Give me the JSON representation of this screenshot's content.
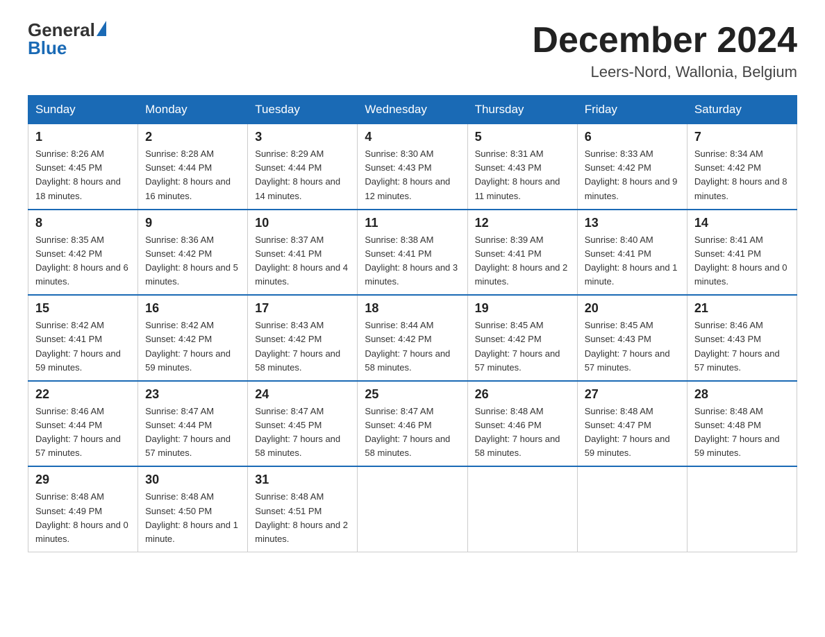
{
  "header": {
    "logo_general": "General",
    "logo_blue": "Blue",
    "month_title": "December 2024",
    "location": "Leers-Nord, Wallonia, Belgium"
  },
  "columns": [
    "Sunday",
    "Monday",
    "Tuesday",
    "Wednesday",
    "Thursday",
    "Friday",
    "Saturday"
  ],
  "weeks": [
    [
      {
        "day": "1",
        "sunrise": "8:26 AM",
        "sunset": "4:45 PM",
        "daylight": "8 hours and 18 minutes."
      },
      {
        "day": "2",
        "sunrise": "8:28 AM",
        "sunset": "4:44 PM",
        "daylight": "8 hours and 16 minutes."
      },
      {
        "day": "3",
        "sunrise": "8:29 AM",
        "sunset": "4:44 PM",
        "daylight": "8 hours and 14 minutes."
      },
      {
        "day": "4",
        "sunrise": "8:30 AM",
        "sunset": "4:43 PM",
        "daylight": "8 hours and 12 minutes."
      },
      {
        "day": "5",
        "sunrise": "8:31 AM",
        "sunset": "4:43 PM",
        "daylight": "8 hours and 11 minutes."
      },
      {
        "day": "6",
        "sunrise": "8:33 AM",
        "sunset": "4:42 PM",
        "daylight": "8 hours and 9 minutes."
      },
      {
        "day": "7",
        "sunrise": "8:34 AM",
        "sunset": "4:42 PM",
        "daylight": "8 hours and 8 minutes."
      }
    ],
    [
      {
        "day": "8",
        "sunrise": "8:35 AM",
        "sunset": "4:42 PM",
        "daylight": "8 hours and 6 minutes."
      },
      {
        "day": "9",
        "sunrise": "8:36 AM",
        "sunset": "4:42 PM",
        "daylight": "8 hours and 5 minutes."
      },
      {
        "day": "10",
        "sunrise": "8:37 AM",
        "sunset": "4:41 PM",
        "daylight": "8 hours and 4 minutes."
      },
      {
        "day": "11",
        "sunrise": "8:38 AM",
        "sunset": "4:41 PM",
        "daylight": "8 hours and 3 minutes."
      },
      {
        "day": "12",
        "sunrise": "8:39 AM",
        "sunset": "4:41 PM",
        "daylight": "8 hours and 2 minutes."
      },
      {
        "day": "13",
        "sunrise": "8:40 AM",
        "sunset": "4:41 PM",
        "daylight": "8 hours and 1 minute."
      },
      {
        "day": "14",
        "sunrise": "8:41 AM",
        "sunset": "4:41 PM",
        "daylight": "8 hours and 0 minutes."
      }
    ],
    [
      {
        "day": "15",
        "sunrise": "8:42 AM",
        "sunset": "4:41 PM",
        "daylight": "7 hours and 59 minutes."
      },
      {
        "day": "16",
        "sunrise": "8:42 AM",
        "sunset": "4:42 PM",
        "daylight": "7 hours and 59 minutes."
      },
      {
        "day": "17",
        "sunrise": "8:43 AM",
        "sunset": "4:42 PM",
        "daylight": "7 hours and 58 minutes."
      },
      {
        "day": "18",
        "sunrise": "8:44 AM",
        "sunset": "4:42 PM",
        "daylight": "7 hours and 58 minutes."
      },
      {
        "day": "19",
        "sunrise": "8:45 AM",
        "sunset": "4:42 PM",
        "daylight": "7 hours and 57 minutes."
      },
      {
        "day": "20",
        "sunrise": "8:45 AM",
        "sunset": "4:43 PM",
        "daylight": "7 hours and 57 minutes."
      },
      {
        "day": "21",
        "sunrise": "8:46 AM",
        "sunset": "4:43 PM",
        "daylight": "7 hours and 57 minutes."
      }
    ],
    [
      {
        "day": "22",
        "sunrise": "8:46 AM",
        "sunset": "4:44 PM",
        "daylight": "7 hours and 57 minutes."
      },
      {
        "day": "23",
        "sunrise": "8:47 AM",
        "sunset": "4:44 PM",
        "daylight": "7 hours and 57 minutes."
      },
      {
        "day": "24",
        "sunrise": "8:47 AM",
        "sunset": "4:45 PM",
        "daylight": "7 hours and 58 minutes."
      },
      {
        "day": "25",
        "sunrise": "8:47 AM",
        "sunset": "4:46 PM",
        "daylight": "7 hours and 58 minutes."
      },
      {
        "day": "26",
        "sunrise": "8:48 AM",
        "sunset": "4:46 PM",
        "daylight": "7 hours and 58 minutes."
      },
      {
        "day": "27",
        "sunrise": "8:48 AM",
        "sunset": "4:47 PM",
        "daylight": "7 hours and 59 minutes."
      },
      {
        "day": "28",
        "sunrise": "8:48 AM",
        "sunset": "4:48 PM",
        "daylight": "7 hours and 59 minutes."
      }
    ],
    [
      {
        "day": "29",
        "sunrise": "8:48 AM",
        "sunset": "4:49 PM",
        "daylight": "8 hours and 0 minutes."
      },
      {
        "day": "30",
        "sunrise": "8:48 AM",
        "sunset": "4:50 PM",
        "daylight": "8 hours and 1 minute."
      },
      {
        "day": "31",
        "sunrise": "8:48 AM",
        "sunset": "4:51 PM",
        "daylight": "8 hours and 2 minutes."
      },
      null,
      null,
      null,
      null
    ]
  ]
}
